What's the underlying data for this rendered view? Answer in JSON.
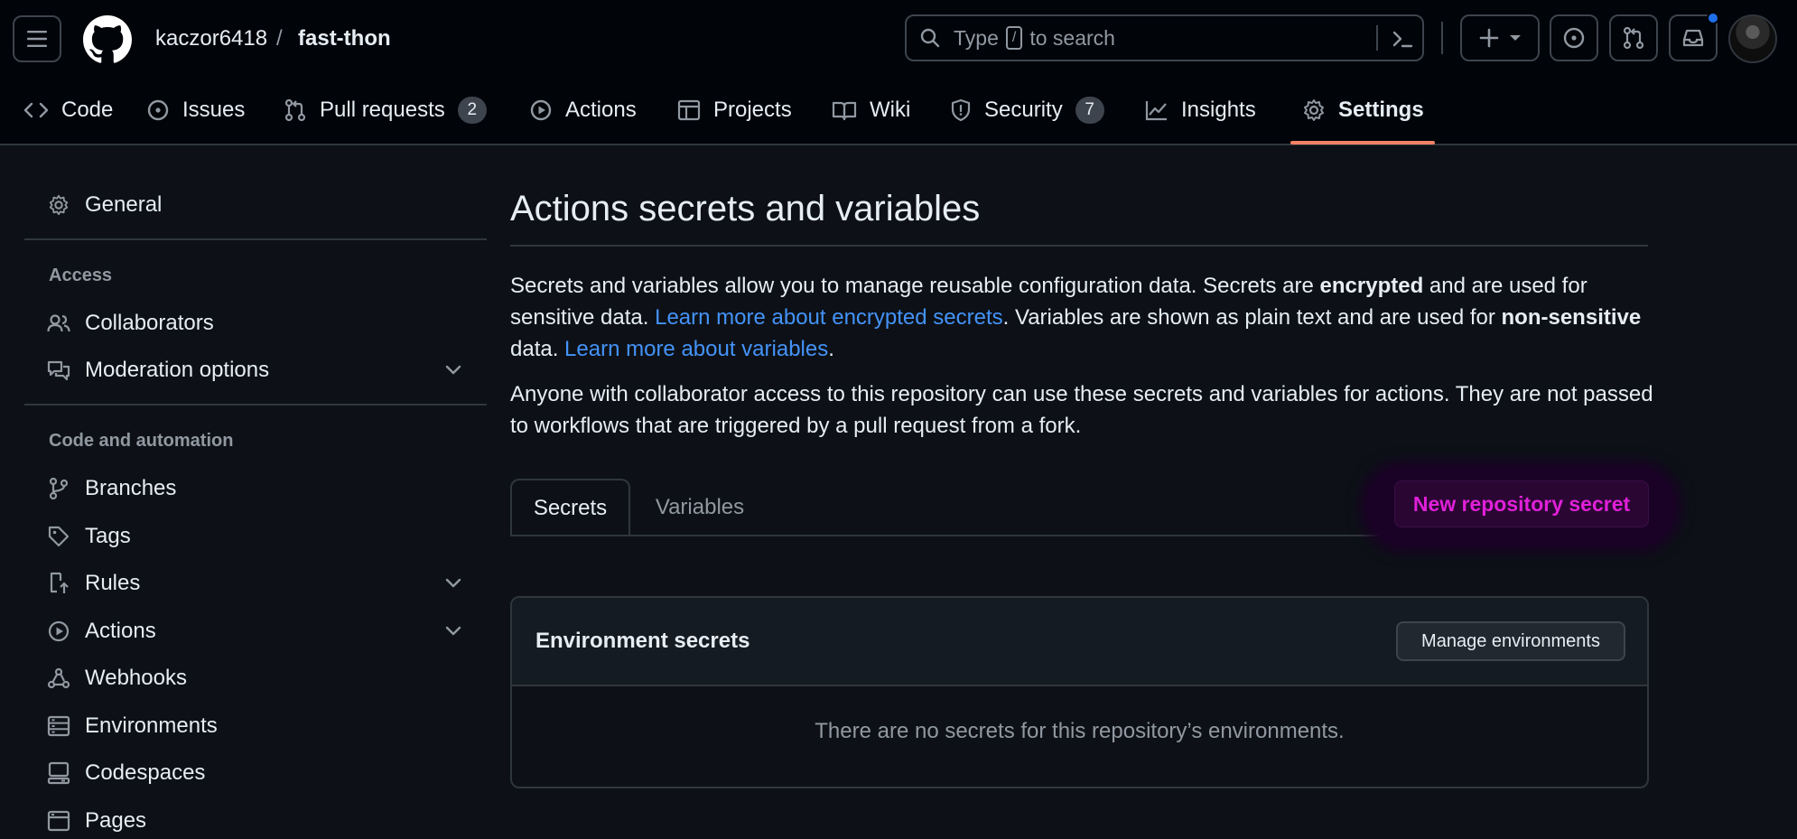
{
  "header": {
    "owner": "kaczor6418",
    "separator": "/",
    "repo": "fast-thon",
    "search": {
      "prefix": "Type",
      "key": "/",
      "suffix": "to search"
    }
  },
  "repo_nav": {
    "tabs": [
      {
        "label": "Code",
        "icon": "code-icon"
      },
      {
        "label": "Issues",
        "icon": "issue-icon"
      },
      {
        "label": "Pull requests",
        "icon": "pull-request-icon",
        "count": "2"
      },
      {
        "label": "Actions",
        "icon": "play-icon"
      },
      {
        "label": "Projects",
        "icon": "table-icon"
      },
      {
        "label": "Wiki",
        "icon": "book-icon"
      },
      {
        "label": "Security",
        "icon": "shield-icon",
        "count": "7"
      },
      {
        "label": "Insights",
        "icon": "graph-icon"
      },
      {
        "label": "Settings",
        "icon": "gear-icon",
        "active": true
      }
    ]
  },
  "sidebar": {
    "general": "General",
    "access_heading": "Access",
    "collaborators": "Collaborators",
    "moderation": "Moderation options",
    "code_heading": "Code and automation",
    "branches": "Branches",
    "tags": "Tags",
    "rules": "Rules",
    "actions": "Actions",
    "webhooks": "Webhooks",
    "environments": "Environments",
    "codespaces": "Codespaces",
    "pages": "Pages"
  },
  "main": {
    "title": "Actions secrets and variables",
    "intro": {
      "t1": "Secrets and variables allow you to manage reusable configuration data. Secrets are ",
      "b1": "encrypted",
      "t2": " and are used for sensitive data. ",
      "link1": "Learn more about encrypted secrets",
      "t3": ". Variables are shown as plain text and are used for ",
      "b2": "non-sensitive",
      "t4": " data. ",
      "link2": "Learn more about variables",
      "t5": "."
    },
    "access_note": "Anyone with collaborator access to this repository can use these secrets and variables for actions. They are not passed to workflows that are triggered by a pull request from a fork.",
    "tabs": {
      "secrets": "Secrets",
      "variables": "Variables"
    },
    "new_secret_button": "New repository secret",
    "environment_secrets": {
      "title": "Environment secrets",
      "manage_button": "Manage environments",
      "empty_text": "There are no secrets for this repository’s environments."
    }
  },
  "colors": {
    "background": "#0d1117",
    "header_bg": "#010409",
    "link": "#4493f8",
    "active_tab_underline": "#f78166",
    "highlight_button_text": "#e020d8",
    "notification_dot": "#1f6feb"
  }
}
